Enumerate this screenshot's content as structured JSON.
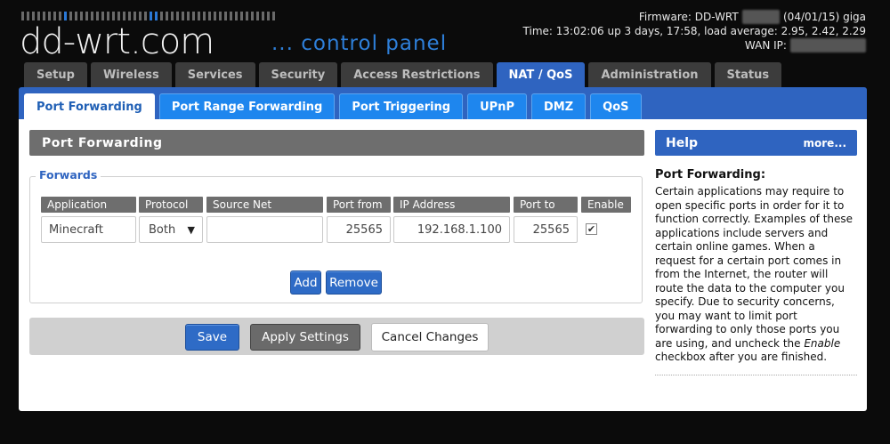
{
  "header": {
    "logo_text": "dd-wrt",
    "logo_suffix": ".com",
    "subtitle": "... control panel",
    "firmware_prefix": "Firmware: DD-WRT",
    "firmware_date": "(04/01/15) giga",
    "time_line": "Time: 13:02:06 up 3 days, 17:58, load average: 2.95, 2.42, 2.29",
    "wan_label": "WAN IP:"
  },
  "main_tabs": [
    "Setup",
    "Wireless",
    "Services",
    "Security",
    "Access Restrictions",
    "NAT / QoS",
    "Administration",
    "Status"
  ],
  "active_main_tab": "NAT / QoS",
  "sub_tabs": [
    "Port Forwarding",
    "Port Range Forwarding",
    "Port Triggering",
    "UPnP",
    "DMZ",
    "QoS"
  ],
  "active_sub_tab": "Port Forwarding",
  "section_title": "Port Forwarding",
  "forwards": {
    "legend": "Forwards",
    "columns": [
      "Application",
      "Protocol",
      "Source Net",
      "Port from",
      "IP Address",
      "Port to",
      "Enable"
    ],
    "row": {
      "application": "Minecraft",
      "protocol": "Both",
      "source_net": "",
      "port_from": "25565",
      "ip_address": "192.168.1.100",
      "port_to": "25565",
      "enable_mark": "✔"
    },
    "add_label": "Add",
    "remove_label": "Remove"
  },
  "actions": {
    "save": "Save",
    "apply": "Apply Settings",
    "cancel": "Cancel Changes"
  },
  "help": {
    "title": "Help",
    "more": "more...",
    "heading": "Port Forwarding:",
    "text_before_em": "Certain applications may require to open specific ports in order for it to function correctly. Examples of these applications include servers and certain online games. When a request for a certain port comes in from the Internet, the router will route the data to the computer you specify. Due to security concerns, you may want to limit port forwarding to only those ports you are using, and uncheck the ",
    "em": "Enable",
    "text_after_em": " checkbox after you are finished."
  },
  "colors": {
    "accent_blue": "#2f64c0",
    "subtab_blue": "#1e86ee",
    "header_gray": "#6e6e6e",
    "background": "#0b0b0b"
  }
}
